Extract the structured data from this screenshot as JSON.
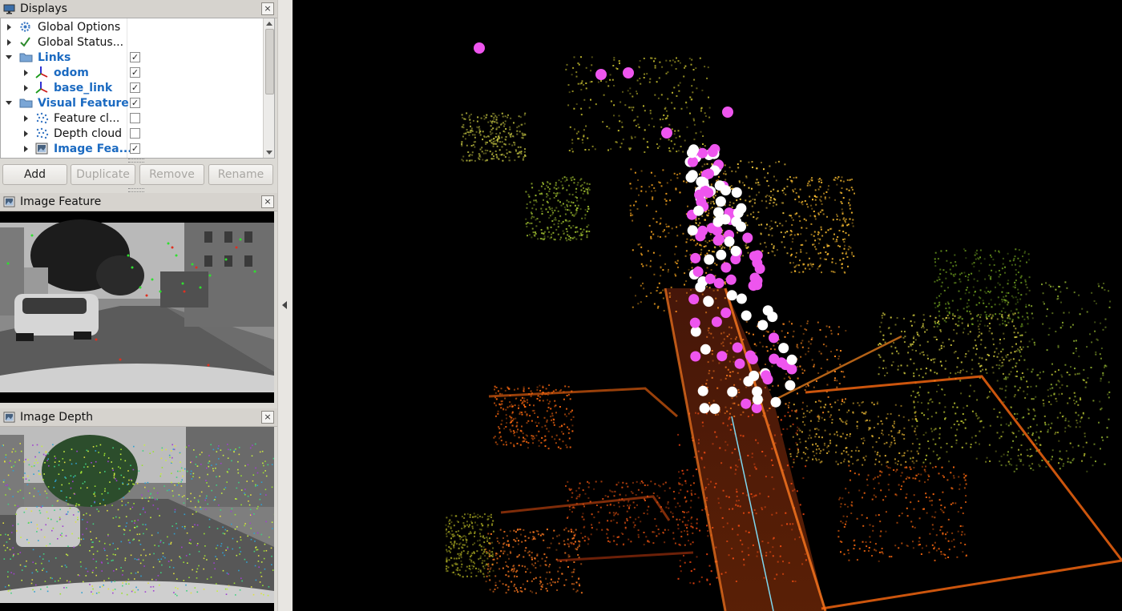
{
  "displays_panel": {
    "title": "Displays",
    "close": "×",
    "rows": [
      {
        "label": "Global Options",
        "icon": "gear-icon",
        "expanded": false,
        "highlight": false,
        "checked": null
      },
      {
        "label": "Global Status...",
        "icon": "check-icon",
        "expanded": false,
        "highlight": false,
        "checked": null
      },
      {
        "label": "Links",
        "icon": "folder-icon",
        "expanded": true,
        "highlight": true,
        "checked": true
      },
      {
        "label": "odom",
        "icon": "axes-icon",
        "expanded": false,
        "highlight": true,
        "checked": true
      },
      {
        "label": "base_link",
        "icon": "axes-icon",
        "expanded": false,
        "highlight": true,
        "checked": true
      },
      {
        "label": "Visual Feature",
        "icon": "folder-icon",
        "expanded": true,
        "highlight": true,
        "checked": true
      },
      {
        "label": "Feature cl...",
        "icon": "pointcloud-icon",
        "expanded": false,
        "highlight": false,
        "checked": false
      },
      {
        "label": "Depth cloud",
        "icon": "pointcloud-icon",
        "expanded": false,
        "highlight": false,
        "checked": false
      },
      {
        "label": "Image Fea...",
        "icon": "image-icon",
        "expanded": false,
        "highlight": true,
        "checked": true
      }
    ]
  },
  "buttons": {
    "add": "Add",
    "duplicate": "Duplicate",
    "remove": "Remove",
    "rename": "Rename"
  },
  "image_feature_panel": {
    "title": "Image Feature",
    "close": "×"
  },
  "image_depth_panel": {
    "title": "Image Depth",
    "close": "×"
  },
  "colors": {
    "highlight_text": "#1b6ac1",
    "viewport_bg": "#000000",
    "feature_magenta": "#ee55ee",
    "feature_white": "#ffffff"
  }
}
